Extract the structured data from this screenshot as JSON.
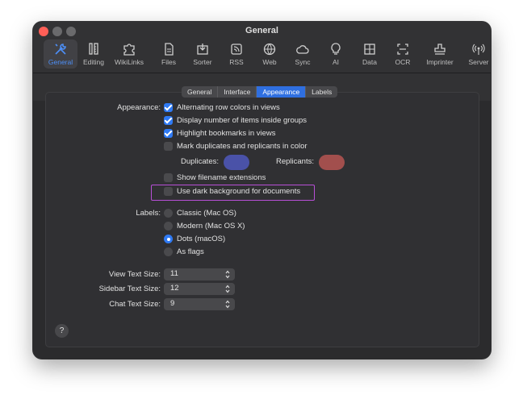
{
  "window": {
    "title": "General"
  },
  "toolbar": {
    "items": [
      {
        "label": "General",
        "icon": "wrench-screwdriver-icon"
      },
      {
        "label": "Editing",
        "icon": "pencil-ruler-icon"
      },
      {
        "label": "WikiLinks",
        "icon": "puzzle-icon"
      },
      {
        "label": "Files",
        "icon": "document-icon"
      },
      {
        "label": "Sorter",
        "icon": "sorter-icon"
      },
      {
        "label": "RSS",
        "icon": "rss-icon"
      },
      {
        "label": "Web",
        "icon": "globe-icon"
      },
      {
        "label": "Sync",
        "icon": "cloud-icon"
      },
      {
        "label": "AI",
        "icon": "lightbulb-icon"
      },
      {
        "label": "Data",
        "icon": "grid-icon"
      },
      {
        "label": "OCR",
        "icon": "scan-icon"
      },
      {
        "label": "Imprinter",
        "icon": "stamp-icon"
      },
      {
        "label": "Server",
        "icon": "antenna-icon"
      }
    ],
    "active": "General"
  },
  "tabs": [
    "General",
    "Interface",
    "Appearance",
    "Labels"
  ],
  "active_tab": "Appearance",
  "appearance": {
    "label": "Appearance:",
    "options": [
      {
        "label": "Alternating row colors in views",
        "checked": true
      },
      {
        "label": "Display number of items inside groups",
        "checked": true
      },
      {
        "label": "Highlight bookmarks in views",
        "checked": true
      },
      {
        "label": "Mark duplicates and replicants in color",
        "checked": false
      }
    ],
    "duplicates_label": "Duplicates:",
    "duplicates_color": "#4a52a8",
    "replicants_label": "Replicants:",
    "replicants_color": "#a24f4d",
    "filename_ext": {
      "label": "Show filename extensions",
      "checked": false
    },
    "dark_bg": {
      "label": "Use dark background for documents",
      "checked": false
    }
  },
  "labels": {
    "label": "Labels:",
    "options": [
      {
        "label": "Classic (Mac OS)",
        "selected": false
      },
      {
        "label": "Modern (Mac OS X)",
        "selected": false
      },
      {
        "label": "Dots (macOS)",
        "selected": true
      },
      {
        "label": "As flags",
        "selected": false
      }
    ]
  },
  "text_sizes": [
    {
      "label": "View Text Size:",
      "value": "11"
    },
    {
      "label": "Sidebar Text Size:",
      "value": "12"
    },
    {
      "label": "Chat Text Size:",
      "value": "9"
    }
  ],
  "help": "?",
  "colors": {
    "accent": "#2f7af4",
    "highlight_border": "#b84fd8"
  }
}
